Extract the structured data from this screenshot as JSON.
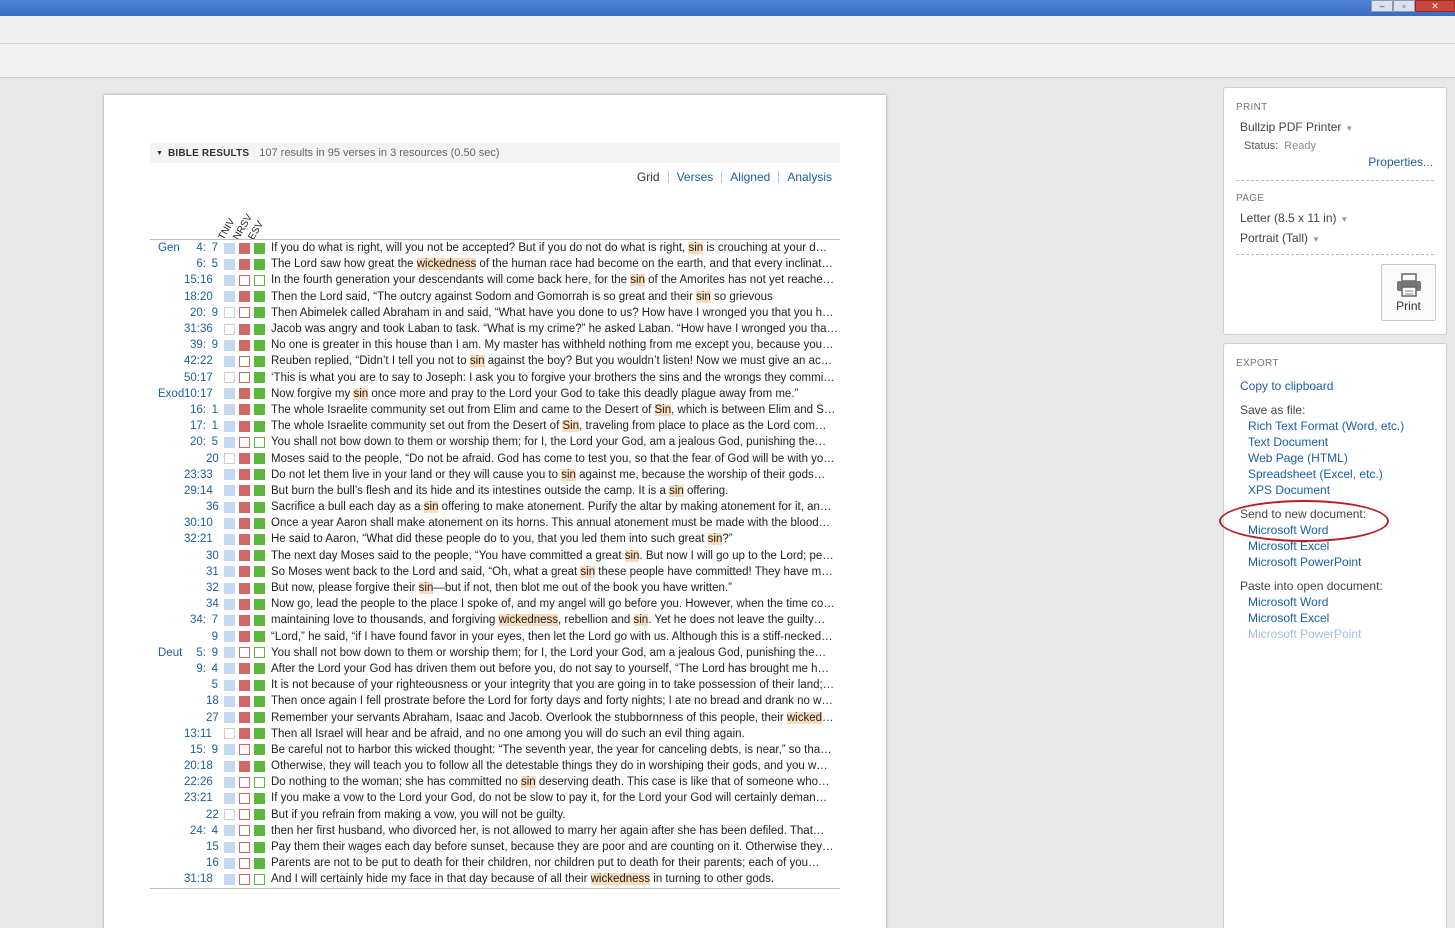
{
  "window": {
    "buttons": {
      "minimize": "–",
      "maximize": "▫",
      "close": "✕"
    }
  },
  "results": {
    "title": "BIBLE RESULTS",
    "summary": "107 results in 95 verses in 3 resources (0.50 sec)",
    "tabs": [
      "Grid",
      "Verses",
      "Aligned",
      "Analysis"
    ],
    "active_tab": "Grid",
    "columns": [
      "TNIV",
      "NRSV",
      "ESV"
    ],
    "rows": [
      {
        "book": "Gen",
        "ch": "4:",
        "vs": "7",
        "b": [
          1,
          1,
          1
        ],
        "segs": [
          [
            "If you do what is right, will you not be accepted? But if you do not do what is right, ",
            0
          ],
          [
            "sin",
            1
          ],
          [
            " is crouching at your d…",
            0
          ]
        ]
      },
      {
        "book": "",
        "ch": "6:",
        "vs": "5",
        "b": [
          1,
          1,
          1
        ],
        "segs": [
          [
            "The Lord saw how great the ",
            0
          ],
          [
            "wickedness",
            1
          ],
          [
            " of the human race had become on the earth, and that every inclinat…",
            0
          ]
        ]
      },
      {
        "book": "",
        "ch": "15:16",
        "vs": "",
        "b": [
          1,
          0,
          0
        ],
        "segs": [
          [
            "In the fourth generation your descendants will come back here, for the ",
            0
          ],
          [
            "sin",
            1
          ],
          [
            " of the Amorites has not yet reache…",
            0
          ]
        ]
      },
      {
        "book": "",
        "ch": "18:20",
        "vs": "",
        "b": [
          1,
          1,
          1
        ],
        "segs": [
          [
            "Then the Lord said, “The outcry against Sodom and Gomorrah is so great and their ",
            0
          ],
          [
            "sin",
            1
          ],
          [
            " so grievous",
            0
          ]
        ]
      },
      {
        "book": "",
        "ch": "20:",
        "vs": "9",
        "b": [
          0,
          0,
          1
        ],
        "segs": [
          [
            "Then Abimelek called Abraham in and said, “What have you done to us? How have I wronged you that you h…",
            0
          ]
        ]
      },
      {
        "book": "",
        "ch": "31:36",
        "vs": "",
        "b": [
          0,
          1,
          1
        ],
        "segs": [
          [
            "Jacob was angry and took Laban to task. “What is my crime?” he asked Laban. “How have I wronged you tha…",
            0
          ]
        ]
      },
      {
        "book": "",
        "ch": "39:",
        "vs": "9",
        "b": [
          1,
          1,
          1
        ],
        "segs": [
          [
            "No one is greater in this house than I am. My master has withheld nothing from me except you, because you…",
            0
          ]
        ]
      },
      {
        "book": "",
        "ch": "42:22",
        "vs": "",
        "b": [
          1,
          0,
          1
        ],
        "segs": [
          [
            "Reuben replied, “Didn’t I tell you not to ",
            0
          ],
          [
            "sin",
            1
          ],
          [
            " against the boy? But you wouldn’t listen! Now we must give an ac…",
            0
          ]
        ]
      },
      {
        "book": "",
        "ch": "50:17",
        "vs": "",
        "b": [
          0,
          0,
          1
        ],
        "segs": [
          [
            "‘This is what you are to say to Joseph: I ask you to forgive your brothers the sins and the wrongs they commi…",
            0
          ]
        ]
      },
      {
        "book": "Exod",
        "ch": "10:17",
        "vs": "",
        "b": [
          1,
          1,
          1
        ],
        "segs": [
          [
            "Now forgive my ",
            0
          ],
          [
            "sin",
            1
          ],
          [
            " once more and pray to the Lord your God to take this deadly plague away from me.”",
            0
          ]
        ]
      },
      {
        "book": "",
        "ch": "16:",
        "vs": "1",
        "b": [
          1,
          1,
          1
        ],
        "segs": [
          [
            "The whole Israelite community set out from Elim and came to the Desert of ",
            0
          ],
          [
            "Sin",
            1
          ],
          [
            ", which is between Elim and S…",
            0
          ]
        ]
      },
      {
        "book": "",
        "ch": "17:",
        "vs": "1",
        "b": [
          1,
          1,
          1
        ],
        "segs": [
          [
            "The whole Israelite community set out from the Desert of ",
            0
          ],
          [
            "Sin",
            1
          ],
          [
            ", traveling from place to place as the Lord com…",
            0
          ]
        ]
      },
      {
        "book": "",
        "ch": "20:",
        "vs": "5",
        "b": [
          1,
          0,
          0
        ],
        "segs": [
          [
            "You shall not bow down to them or worship them; for I, the Lord your God, am a jealous God, punishing the…",
            0
          ]
        ]
      },
      {
        "book": "",
        "ch": "",
        "vs": "20",
        "b": [
          0,
          1,
          1
        ],
        "segs": [
          [
            "Moses said to the people, “Do not be afraid. God has come to test you, so that the fear of God will be with yo…",
            0
          ]
        ]
      },
      {
        "book": "",
        "ch": "23:33",
        "vs": "",
        "b": [
          1,
          1,
          1
        ],
        "segs": [
          [
            "Do not let them live in your land or they will cause you to ",
            0
          ],
          [
            "sin",
            1
          ],
          [
            " against me, because the worship of their gods…",
            0
          ]
        ]
      },
      {
        "book": "",
        "ch": "29:14",
        "vs": "",
        "b": [
          1,
          1,
          1
        ],
        "segs": [
          [
            "But burn the bull’s flesh and its hide and its intestines outside the camp. It is a ",
            0
          ],
          [
            "sin",
            1
          ],
          [
            " offering.",
            0
          ]
        ]
      },
      {
        "book": "",
        "ch": "",
        "vs": "36",
        "b": [
          1,
          1,
          1
        ],
        "segs": [
          [
            "Sacrifice a bull each day as a ",
            0
          ],
          [
            "sin",
            1
          ],
          [
            " offering to make atonement. Purify the altar by making atonement for it, an…",
            0
          ]
        ]
      },
      {
        "book": "",
        "ch": "30:10",
        "vs": "",
        "b": [
          1,
          1,
          1
        ],
        "segs": [
          [
            "Once a year Aaron shall make atonement on its horns. This annual atonement must be made with the blood…",
            0
          ]
        ]
      },
      {
        "book": "",
        "ch": "32:21",
        "vs": "",
        "b": [
          1,
          1,
          1
        ],
        "segs": [
          [
            "He said to Aaron, “What did these people do to you, that you led them into such great ",
            0
          ],
          [
            "sin",
            1
          ],
          [
            "?”",
            0
          ]
        ]
      },
      {
        "book": "",
        "ch": "",
        "vs": "30",
        "b": [
          1,
          1,
          1
        ],
        "segs": [
          [
            "The next day Moses said to the people, “You have committed a great ",
            0
          ],
          [
            "sin",
            1
          ],
          [
            ". But now I will go up to the Lord; pe…",
            0
          ]
        ]
      },
      {
        "book": "",
        "ch": "",
        "vs": "31",
        "b": [
          1,
          1,
          1
        ],
        "segs": [
          [
            "So Moses went back to the Lord and said, “Oh, what a great ",
            0
          ],
          [
            "sin",
            1
          ],
          [
            " these people have committed! They have m…",
            0
          ]
        ]
      },
      {
        "book": "",
        "ch": "",
        "vs": "32",
        "b": [
          1,
          1,
          1
        ],
        "segs": [
          [
            "But now, please forgive their ",
            0
          ],
          [
            "sin",
            1
          ],
          [
            "—but if not, then blot me out of the book you have written.”",
            0
          ]
        ]
      },
      {
        "book": "",
        "ch": "",
        "vs": "34",
        "b": [
          1,
          1,
          1
        ],
        "segs": [
          [
            "Now go, lead the people to the place I spoke of, and my angel will go before you. However, when the time co…",
            0
          ]
        ]
      },
      {
        "book": "",
        "ch": "34:",
        "vs": "7",
        "b": [
          1,
          1,
          1
        ],
        "segs": [
          [
            "maintaining love to thousands, and forgiving ",
            0
          ],
          [
            "wickedness",
            1
          ],
          [
            ", rebellion and ",
            0
          ],
          [
            "sin",
            1
          ],
          [
            ". Yet he does not leave the guilty…",
            0
          ]
        ]
      },
      {
        "book": "",
        "ch": "",
        "vs": "9",
        "b": [
          1,
          1,
          1
        ],
        "segs": [
          [
            "“Lord,” he said, “if I have found favor in your eyes, then let the Lord go with us. Although this is a stiff-necked…",
            0
          ]
        ]
      },
      {
        "book": "Deut",
        "ch": "5:",
        "vs": "9",
        "b": [
          1,
          0,
          0
        ],
        "segs": [
          [
            "You shall not bow down to them or worship them; for I, the Lord your God, am a jealous God, punishing the…",
            0
          ]
        ]
      },
      {
        "book": "",
        "ch": "9:",
        "vs": "4",
        "b": [
          1,
          1,
          1
        ],
        "segs": [
          [
            "After the Lord your God has driven them out before you, do not say to yourself, “The Lord has brought me h…",
            0
          ]
        ]
      },
      {
        "book": "",
        "ch": "",
        "vs": "5",
        "b": [
          1,
          1,
          1
        ],
        "segs": [
          [
            "It is not because of your righteousness or your integrity that you are going in to take possession of their land;…",
            0
          ]
        ]
      },
      {
        "book": "",
        "ch": "",
        "vs": "18",
        "b": [
          1,
          1,
          1
        ],
        "segs": [
          [
            "Then once again I fell prostrate before the Lord for forty days and forty nights; I ate no bread and drank no w…",
            0
          ]
        ]
      },
      {
        "book": "",
        "ch": "",
        "vs": "27",
        "b": [
          1,
          1,
          1
        ],
        "segs": [
          [
            "Remember your servants Abraham, Isaac and Jacob. Overlook the stubbornness of this people, their ",
            0
          ],
          [
            "wicked",
            1
          ],
          [
            "…",
            0
          ]
        ]
      },
      {
        "book": "",
        "ch": "13:11",
        "vs": "",
        "b": [
          0,
          1,
          1
        ],
        "segs": [
          [
            "Then all Israel will hear and be afraid, and no one among you will do such an evil thing again.",
            0
          ]
        ]
      },
      {
        "book": "",
        "ch": "15:",
        "vs": "9",
        "b": [
          1,
          0,
          1
        ],
        "segs": [
          [
            "Be careful not to harbor this wicked thought: “The seventh year, the year for canceling debts, is near,” so tha…",
            0
          ]
        ]
      },
      {
        "book": "",
        "ch": "20:18",
        "vs": "",
        "b": [
          1,
          1,
          1
        ],
        "segs": [
          [
            "Otherwise, they will teach you to follow all the detestable things they do in worshiping their gods, and you w…",
            0
          ]
        ]
      },
      {
        "book": "",
        "ch": "22:26",
        "vs": "",
        "b": [
          1,
          0,
          0
        ],
        "segs": [
          [
            "Do nothing to the woman; she has committed no ",
            0
          ],
          [
            "sin",
            1
          ],
          [
            " deserving death. This case is like that of someone who…",
            0
          ]
        ]
      },
      {
        "book": "",
        "ch": "23:21",
        "vs": "",
        "b": [
          1,
          0,
          1
        ],
        "segs": [
          [
            "If you make a vow to the Lord your God, do not be slow to pay it, for the Lord your God will certainly deman…",
            0
          ]
        ]
      },
      {
        "book": "",
        "ch": "",
        "vs": "22",
        "b": [
          0,
          0,
          1
        ],
        "segs": [
          [
            "But if you refrain from making a vow, you will not be guilty.",
            0
          ]
        ]
      },
      {
        "book": "",
        "ch": "24:",
        "vs": "4",
        "b": [
          1,
          0,
          1
        ],
        "segs": [
          [
            "then her first husband, who divorced her, is not allowed to marry her again after she has been defiled. That…",
            0
          ]
        ]
      },
      {
        "book": "",
        "ch": "",
        "vs": "15",
        "b": [
          1,
          0,
          1
        ],
        "segs": [
          [
            "Pay them their wages each day before sunset, because they are poor and are counting on it. Otherwise they…",
            0
          ]
        ]
      },
      {
        "book": "",
        "ch": "",
        "vs": "16",
        "b": [
          1,
          0,
          1
        ],
        "segs": [
          [
            "Parents are not to be put to death for their children, nor children put to death for their parents; each of you…",
            0
          ]
        ]
      },
      {
        "book": "",
        "ch": "31:18",
        "vs": "",
        "b": [
          1,
          0,
          0
        ],
        "segs": [
          [
            "And I will certainly hide my face in that day because of all their ",
            0
          ],
          [
            "wickedness",
            1
          ],
          [
            " in turning to other gods.",
            0
          ]
        ]
      }
    ]
  },
  "print": {
    "label": "PRINT",
    "printer": "Bullzip PDF Printer",
    "status_key": "Status:",
    "status_value": "Ready",
    "properties": "Properties...",
    "page_label": "PAGE",
    "paper": "Letter (8.5 x 11 in)",
    "orientation": "Portrait (Tall)",
    "print_button": "Print"
  },
  "export": {
    "label": "EXPORT",
    "copy": "Copy to clipboard",
    "save_label": "Save as file:",
    "save_items": [
      "Rich Text Format (Word, etc.)",
      "Text Document",
      "Web Page (HTML)",
      "Spreadsheet (Excel, etc.)",
      "XPS Document"
    ],
    "send_label": "Send to new document:",
    "send_items": [
      "Microsoft Word",
      "Microsoft Excel",
      "Microsoft PowerPoint"
    ],
    "paste_label": "Paste into open document:",
    "paste_items": [
      "Microsoft Word",
      "Microsoft Excel",
      "Microsoft PowerPoint"
    ],
    "paste_disabled": [
      false,
      false,
      true
    ]
  },
  "colors": {
    "link": "#1a5fa8",
    "highlight": "#f8dcbc",
    "tniv_box": "#c5d9ee",
    "nrsv_box": "#d06868",
    "esv_box": "#5cb83d",
    "annotation_circle": "#b3232b"
  }
}
